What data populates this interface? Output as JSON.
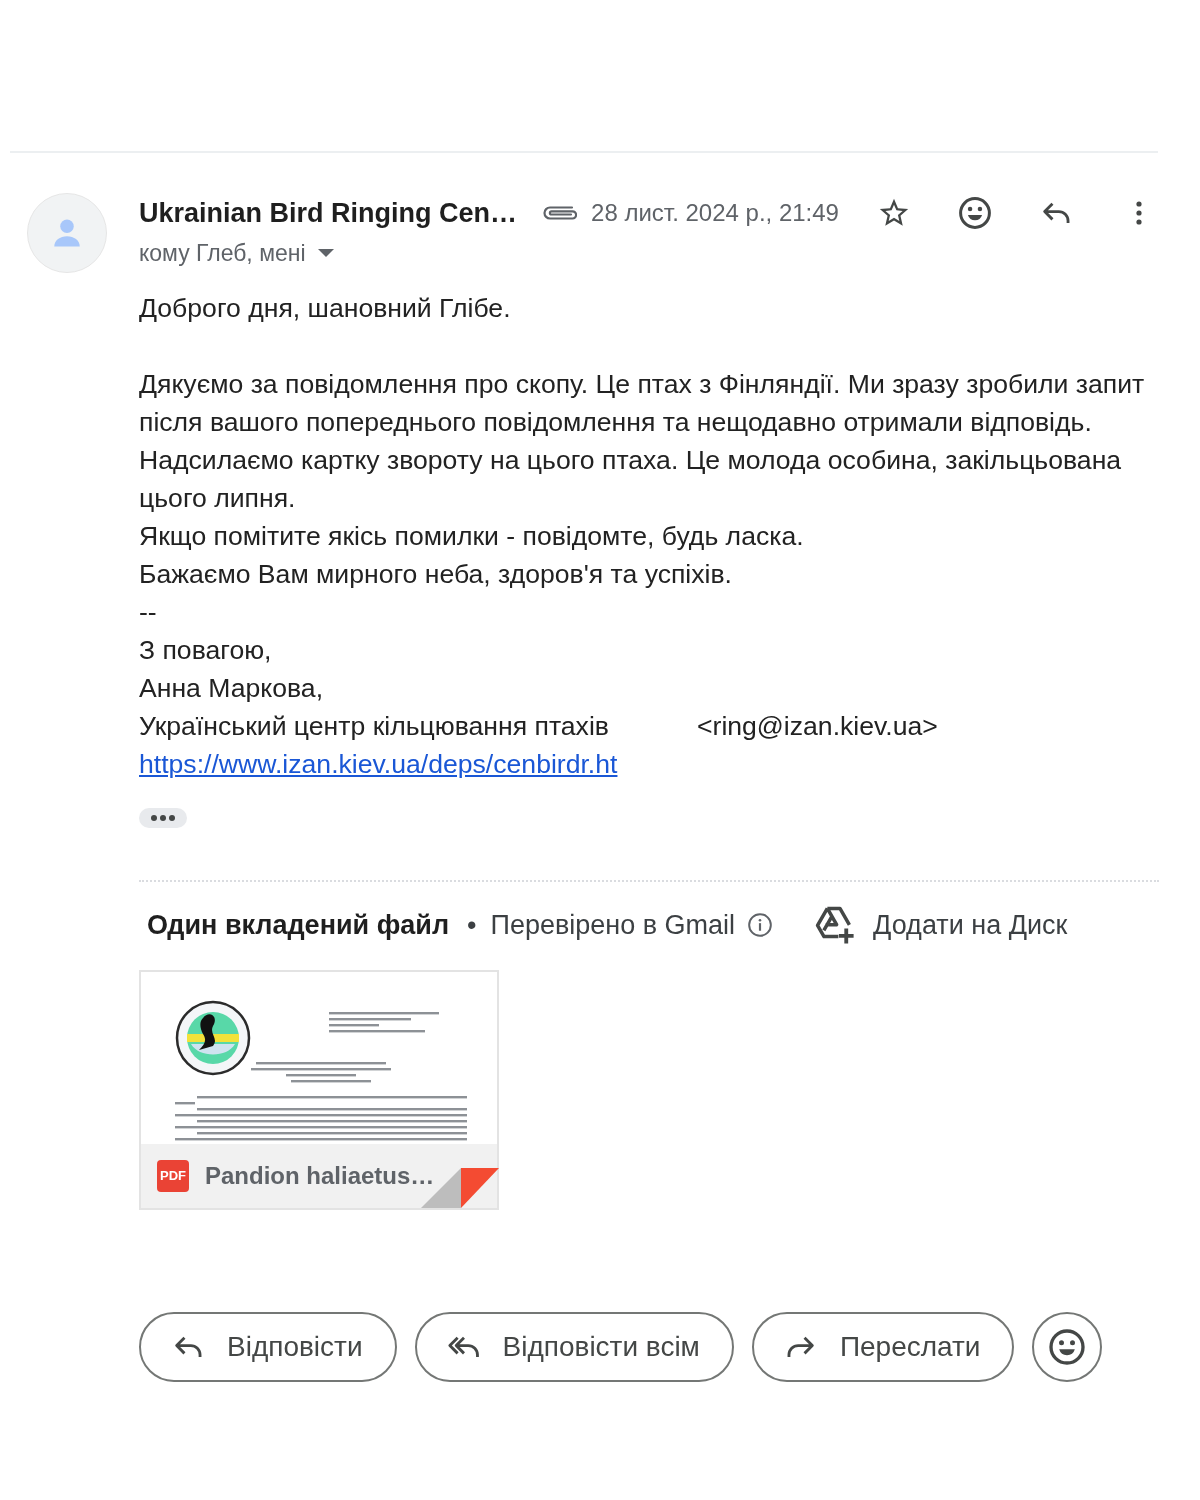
{
  "message": {
    "sender": "Ukrainian Bird Ringing Cen…",
    "date": "28 лист. 2024 р., 21:49",
    "starred": false,
    "recipients": "кому Глеб, мені"
  },
  "body": {
    "blocks": [
      {
        "lines": [
          "Доброго дня, шановний Глібе."
        ]
      },
      {
        "lines": [
          "Дякуємо за повідомлення про скопу. Це птах з Фінляндії. Ми зразу зробили запит після вашого попереднього повідомлення та нещодавно отримали відповідь. Надсилаємо картку звороту на цього птаха. Це молода особина, закільцьована цього липня.",
          "Якщо помітите якісь помилки - повідомте, будь ласка.",
          "Бажаємо Вам мирного неба, здоров'я та успіхів.",
          "--",
          "З повагою,",
          "Анна Маркова,"
        ]
      }
    ],
    "organization": "Український центр кільцювання птахів",
    "email": "<ring@izan.kiev.ua>",
    "link": "https://www.izan.kiev.ua/deps/cenbirdr.ht"
  },
  "attachments": {
    "title": "Один вкладений файл",
    "separator": "•",
    "verified": "Перевірено в Gmail",
    "drive_action": "Додати на Диск",
    "files": [
      {
        "type": "PDF",
        "name": "Pandion haliaetus…"
      }
    ]
  },
  "actions": [
    {
      "kind": "reply",
      "label": "Відповісти"
    },
    {
      "kind": "reply_all",
      "label": "Відповісти всім"
    },
    {
      "kind": "forward",
      "label": "Переслати"
    },
    {
      "kind": "emoji"
    }
  ]
}
